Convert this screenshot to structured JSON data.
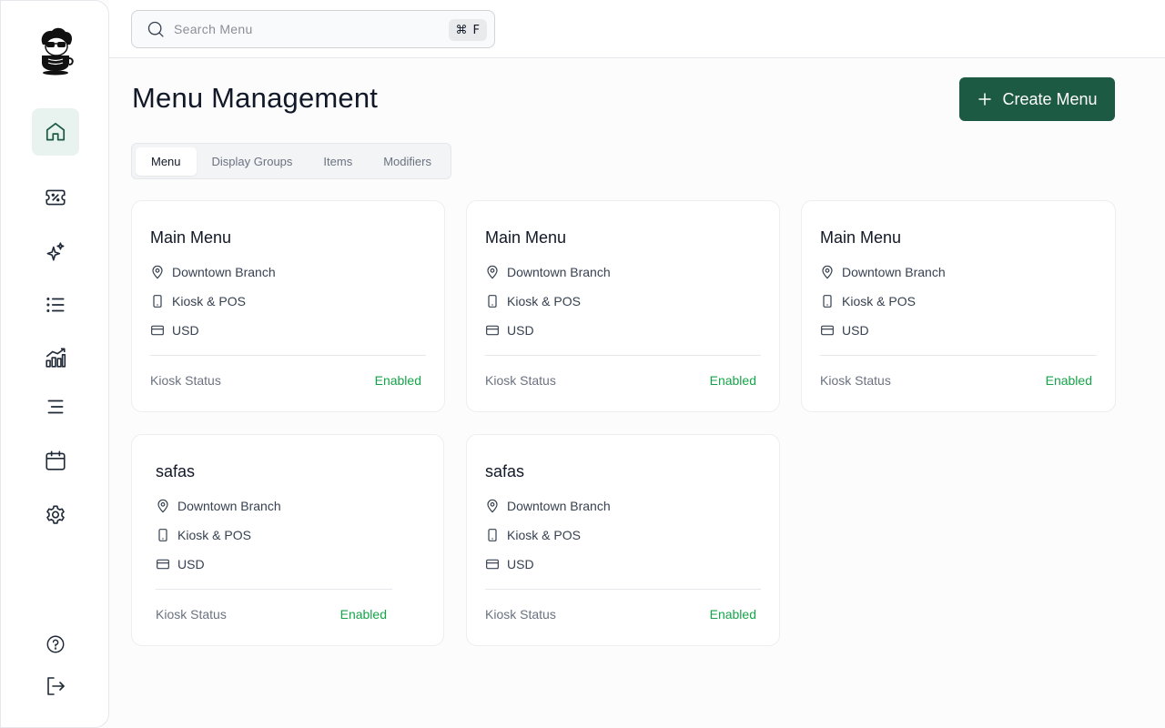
{
  "search": {
    "placeholder": "Search Menu",
    "shortcut_symbol": "⌘",
    "shortcut_key": "F"
  },
  "page": {
    "title": "Menu Management",
    "create_label": "Create Menu"
  },
  "tabs": [
    {
      "label": "Menu",
      "active": true
    },
    {
      "label": "Display Groups",
      "active": false
    },
    {
      "label": "Items",
      "active": false
    },
    {
      "label": "Modifiers",
      "active": false
    }
  ],
  "sidebar": {
    "items": [
      {
        "icon": "home-icon",
        "active": true
      },
      {
        "icon": "discount-ticket-icon",
        "active": false
      },
      {
        "icon": "sparkles-icon",
        "active": false
      },
      {
        "icon": "list-icon",
        "active": false
      },
      {
        "icon": "analytics-chart-icon",
        "active": false
      },
      {
        "icon": "menu-lines-icon",
        "active": false
      },
      {
        "icon": "calendar-icon",
        "active": false
      },
      {
        "icon": "gear-icon",
        "active": false
      }
    ],
    "bottom": [
      {
        "icon": "help-circle-icon"
      },
      {
        "icon": "logout-icon"
      }
    ]
  },
  "cards": [
    {
      "title": "Main Menu",
      "location": "Downtown Branch",
      "device": "Kiosk & POS",
      "currency": "USD",
      "status_label": "Kiosk Status",
      "status": "Enabled"
    },
    {
      "title": "Main Menu",
      "location": "Downtown Branch",
      "device": "Kiosk & POS",
      "currency": "USD",
      "status_label": "Kiosk Status",
      "status": "Enabled"
    },
    {
      "title": "Main Menu",
      "location": "Downtown Branch",
      "device": "Kiosk & POS",
      "currency": "USD",
      "status_label": "Kiosk Status",
      "status": "Enabled"
    },
    {
      "title": "safas",
      "location": "Downtown Branch",
      "device": "Kiosk & POS",
      "currency": "USD",
      "status_label": "Kiosk Status",
      "status": "Enabled"
    },
    {
      "title": "safas",
      "location": "Downtown Branch",
      "device": "Kiosk & POS",
      "currency": "USD",
      "status_label": "Kiosk Status",
      "status": "Enabled"
    }
  ],
  "colors": {
    "brand": "#1c5a43",
    "active_nav_bg": "#e8f2ee",
    "enabled": "#16a34a"
  }
}
